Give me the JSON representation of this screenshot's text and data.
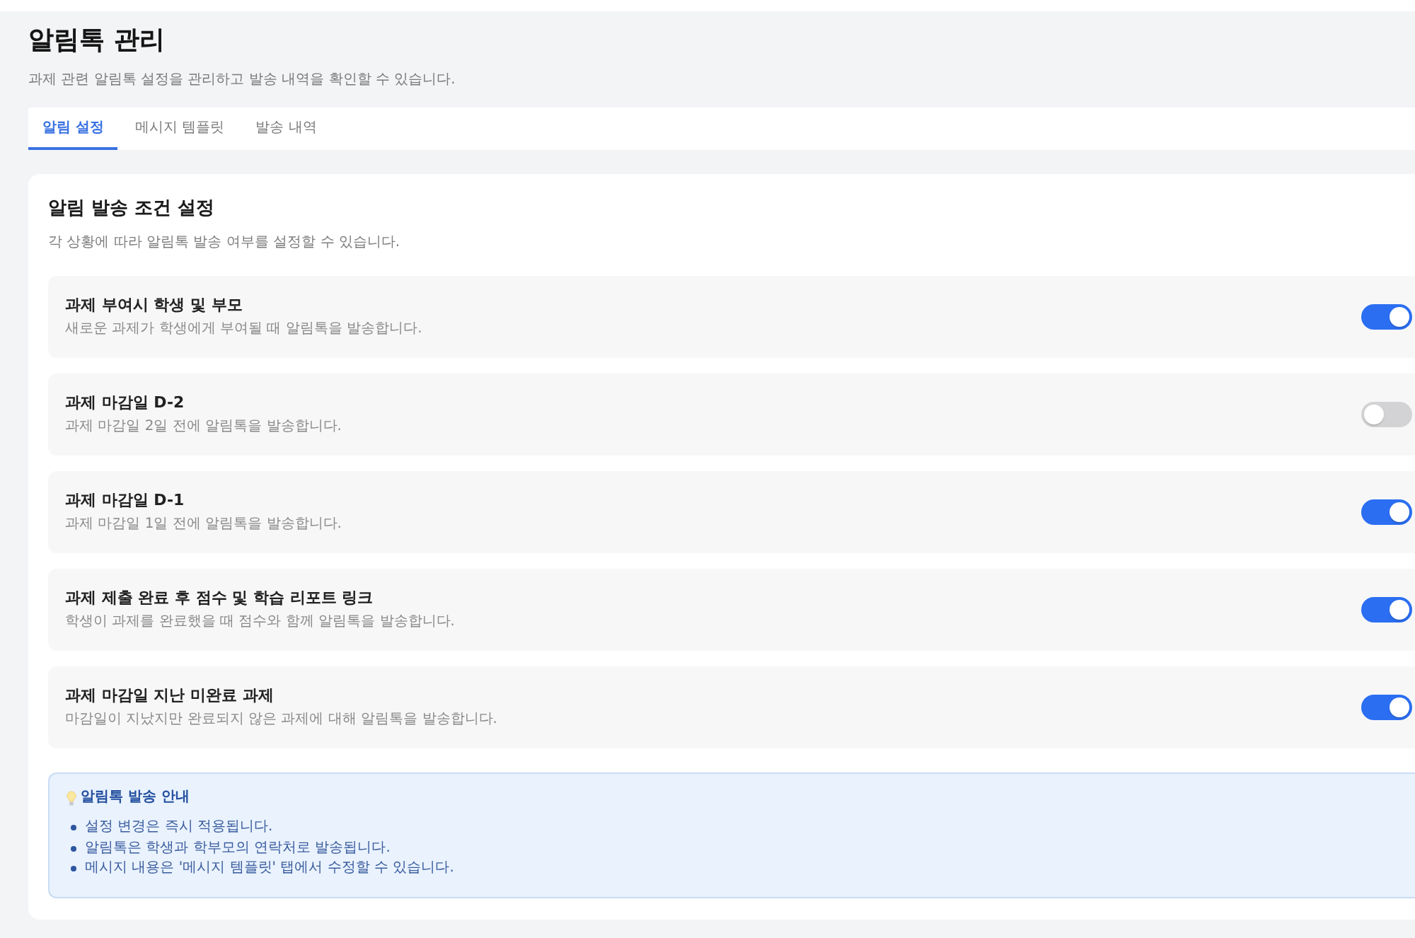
{
  "page": {
    "title": "알림톡 관리",
    "subtitle": "과제 관련 알림톡 설정을 관리하고 발송 내역을 확인할 수 있습니다."
  },
  "tabs": [
    {
      "label": "알림 설정",
      "selected": true
    },
    {
      "label": "메시지 템플릿",
      "selected": false
    },
    {
      "label": "발송 내역",
      "selected": false
    }
  ],
  "settings": {
    "title": "알림 발송 조건 설정",
    "subtitle": "각 상황에 따라 알림톡 발송 여부를 설정할 수 있습니다.",
    "items": [
      {
        "title": "과제 부여시 학생 및 부모",
        "description": "새로운 과제가 학생에게 부여될 때 알림톡을 발송합니다.",
        "on": true
      },
      {
        "title": "과제 마감일 D-2",
        "description": "과제 마감일 2일 전에 알림톡을 발송합니다.",
        "on": false
      },
      {
        "title": "과제 마감일 D-1",
        "description": "과제 마감일 1일 전에 알림톡을 발송합니다.",
        "on": true
      },
      {
        "title": "과제 제출 완료 후 점수 및 학습 리포트 링크",
        "description": "학생이 과제를 완료했을 때 점수와 함께 알림톡을 발송합니다.",
        "on": true
      },
      {
        "title": "과제 마감일 지난 미완료 과제",
        "description": "마감일이 지났지만 완료되지 않은 과제에 대해 알림톡을 발송합니다.",
        "on": true
      }
    ]
  },
  "notice": {
    "title": "알림톡 발송 안내",
    "items": [
      "설정 변경은 즉시 적용됩니다.",
      "알림톡은 학생과 학부모의 연락처로 발송됩니다.",
      "메시지 내용은 '메시지 템플릿' 탭에서 수정할 수 있습니다."
    ]
  }
}
